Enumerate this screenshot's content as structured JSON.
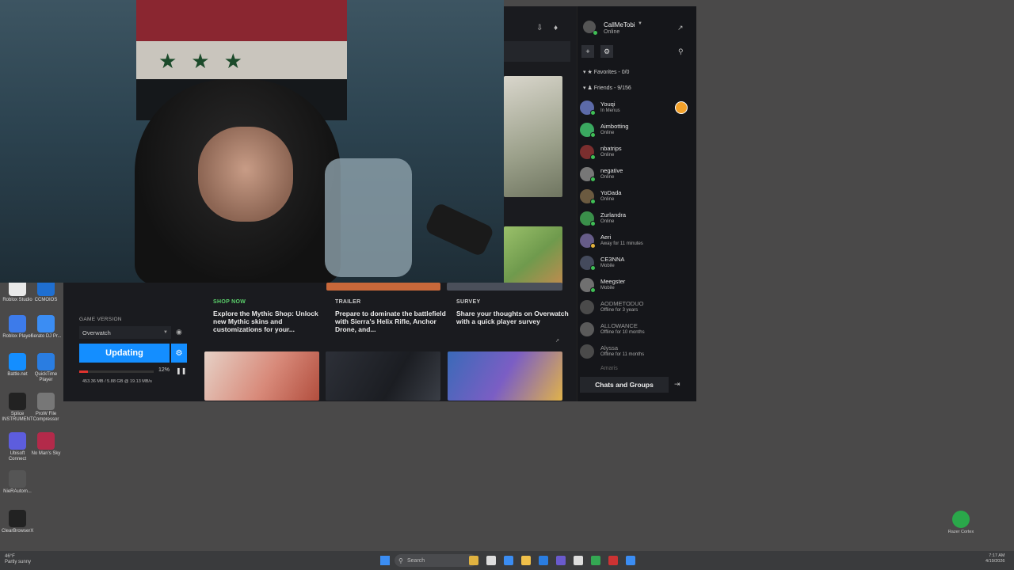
{
  "desktop_icons": [
    {
      "label": "Roblox Studio",
      "color": "#e9e9e9"
    },
    {
      "label": "CCMOIOS",
      "color": "#1f6fd1"
    },
    {
      "label": "Roblox Player",
      "color": "#3d7bea"
    },
    {
      "label": "Serato DJ Pr...",
      "color": "#3b8df3"
    },
    {
      "label": "Battle.net",
      "color": "#148eff"
    },
    {
      "label": "QuickTime Player",
      "color": "#2a7de1"
    },
    {
      "label": "Splice INSTRUMENT",
      "color": "#222222"
    },
    {
      "label": "ProW File Compressor",
      "color": "#777777"
    },
    {
      "label": "Ubisoft Connect",
      "color": "#5d5ddd"
    },
    {
      "label": "No Man's Sky",
      "color": "#b32a4a"
    },
    {
      "label": "NieRAutom...",
      "color": "#555555"
    },
    {
      "label": "ClearBrowserX",
      "color": "#222222"
    }
  ],
  "header": {
    "username": "CallMeTobi",
    "status": "Online"
  },
  "game": {
    "version_label": "GAME VERSION",
    "selected_game": "Overwatch",
    "update_button": "Updating",
    "progress_percent": 12,
    "progress_text": "12%",
    "speed_text": "453.36 MB / 5.88 GB @ 19.13 MB/s"
  },
  "news_cards": [
    {
      "tag": "SHOP NOW",
      "title": "Explore the Mythic Shop: Unlock new Mythic skins and customizations for your..."
    },
    {
      "tag": "TRAILER",
      "title": "Prepare to dominate the battlefield with Sierra's Helix Rifle, Anchor Drone, and..."
    },
    {
      "tag": "SURVEY",
      "title": "Share your thoughts on Overwatch with a quick player survey"
    }
  ],
  "friends": {
    "favorites_label": "Favorites - 0/0",
    "friends_label": "Friends - 9/156",
    "list": [
      {
        "name": "Youqi",
        "status": "In Menus",
        "state": "online",
        "color": "#5c6aa8"
      },
      {
        "name": "Aimbotting",
        "status": "Online",
        "state": "online",
        "color": "#3aa860"
      },
      {
        "name": "nbatrips",
        "status": "Online",
        "state": "online",
        "color": "#7a2e2e"
      },
      {
        "name": "negative",
        "status": "Online",
        "state": "online",
        "color": "#777777"
      },
      {
        "name": "YoDada",
        "status": "Online",
        "state": "online",
        "color": "#6b5a40"
      },
      {
        "name": "Zurlandra",
        "status": "Online",
        "state": "online",
        "color": "#3a8f4a"
      },
      {
        "name": "Aeri",
        "status": "Away for 11 minutes",
        "state": "away",
        "color": "#665c88"
      },
      {
        "name": "CE3NNA",
        "status": "Mobile",
        "state": "online",
        "color": "#444a5c"
      },
      {
        "name": "Meegster",
        "status": "Mobile",
        "state": "online",
        "color": "#707070"
      },
      {
        "name": "AODMETODUO",
        "status": "Offline for 3 years",
        "state": "offline",
        "color": "#4a4a4a"
      },
      {
        "name": "ALLOWANCE",
        "status": "Offline for 10 months",
        "state": "offline",
        "color": "#5a5a5a"
      },
      {
        "name": "Alyssa",
        "status": "Offline for 11 months",
        "state": "offline",
        "color": "#4a4a4a"
      }
    ],
    "partial_name": "Amaris",
    "chats_button": "Chats and Groups"
  },
  "taskbar": {
    "search_placeholder": "Search",
    "weather_temp": "46°F",
    "weather_desc": "Partly sunny",
    "time": "7:17 AM",
    "date": "4/19/2026"
  },
  "razer_label": "Razer Cortex",
  "colors": {
    "accent_blue": "#148eff",
    "progress_red": "#e0342f",
    "online_green": "#3fbf55",
    "away_yellow": "#e3b23c",
    "shop_green": "#5bd16b"
  }
}
